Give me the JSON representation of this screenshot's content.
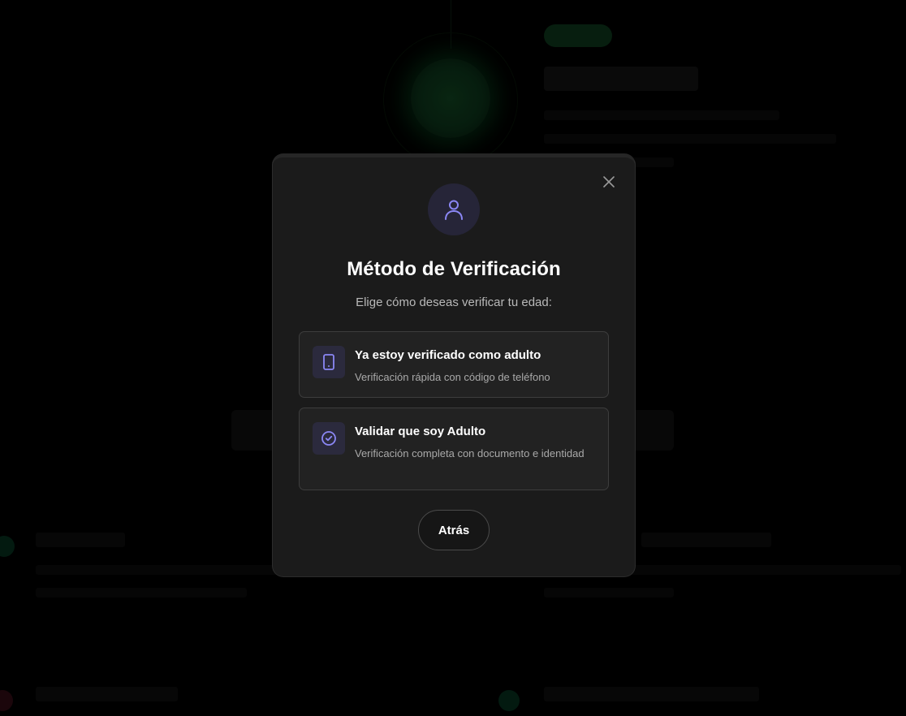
{
  "modal": {
    "title": "Método de Verificación",
    "subtitle": "Elige cómo deseas verificar tu edad:",
    "header_icon": "user-icon",
    "close_icon": "close-icon",
    "options": [
      {
        "icon": "phone-icon",
        "title": "Ya estoy verificado como adulto",
        "description": "Verificación rápida con código de teléfono"
      },
      {
        "icon": "check-circle-icon",
        "title": "Validar que soy Adulto",
        "description": "Verificación completa con documento e identidad"
      }
    ],
    "back_label": "Atrás"
  },
  "colors": {
    "modal_bg": "#1b1b1b",
    "accent": "#8b87f5",
    "option_bg": "#222222",
    "icon_tile_bg": "#2b2a3d",
    "background_glow": "#0e3a1c"
  }
}
